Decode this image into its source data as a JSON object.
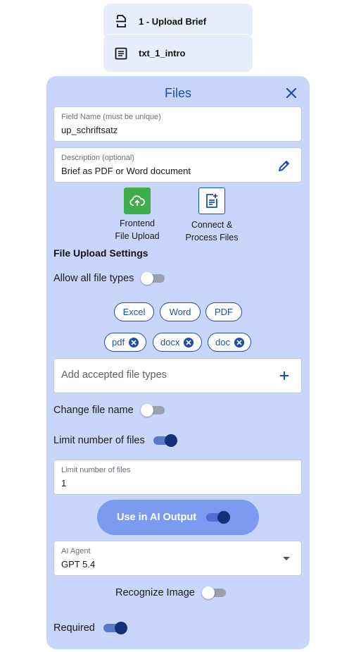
{
  "nodes": [
    {
      "label": "1 - Upload Brief",
      "icon": "file-upload-icon"
    },
    {
      "label": "txt_1_intro",
      "icon": "document-lines-icon"
    }
  ],
  "panel": {
    "title": "Files",
    "close_icon": "close-icon"
  },
  "field_name": {
    "label": "Field Name (must be unique)",
    "value": "up_schriftsatz"
  },
  "description": {
    "label": "Description (optional)",
    "value": "Brief as PDF or Word document",
    "edit_icon": "pencil-icon"
  },
  "tiles": {
    "upload": {
      "label_line1": "Frontend",
      "label_line2": "File Upload",
      "icon": "cloud-upload-icon"
    },
    "connect": {
      "label_line1": "Connect &",
      "label_line2": "Process Files",
      "icon": "document-plus-icon"
    }
  },
  "settings_title": "File Upload Settings",
  "allow_all": {
    "label": "Allow all file types",
    "on": false
  },
  "presets": [
    "Excel",
    "Word",
    "PDF"
  ],
  "accepted_tags": [
    "pdf",
    "docx",
    "doc"
  ],
  "accept_input": {
    "placeholder": "Add accepted file types"
  },
  "change_name": {
    "label": "Change file name",
    "on": false
  },
  "limit_files": {
    "label": "Limit number of files",
    "on": true
  },
  "limit_field": {
    "label": "Limit number of files",
    "value": "1"
  },
  "ai_output": {
    "label": "Use in AI Output",
    "on": true
  },
  "ai_agent": {
    "label": "AI Agent",
    "value": "GPT 5.4"
  },
  "recognize_image": {
    "label": "Recognize Image",
    "on": false
  },
  "required": {
    "label": "Required",
    "on": true
  },
  "colors": {
    "panel_bg": "#c9d6fb",
    "accent": "#1e4fa8",
    "upload_green": "#3fae49",
    "ai_button": "#7c9bf0",
    "toggle_on": "#14307a"
  }
}
